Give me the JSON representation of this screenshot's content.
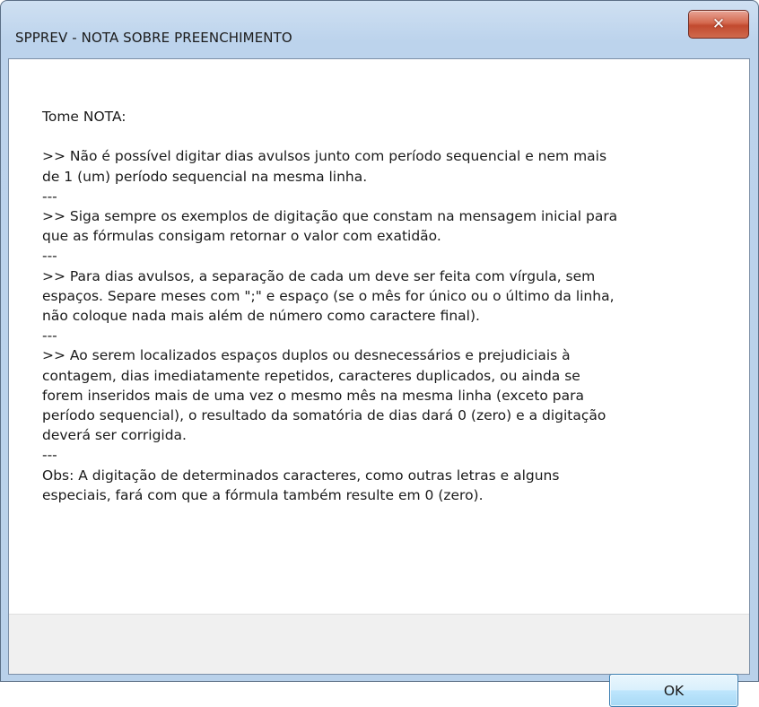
{
  "window": {
    "title": "SPPREV - NOTA SOBRE PREENCHIMENTO",
    "close_icon": "close-icon"
  },
  "message": {
    "lines": [
      "Tome NOTA:",
      "",
      ">> Não é possível digitar dias avulsos junto com período sequencial e nem mais",
      "de 1 (um) período sequencial na mesma linha.",
      "---",
      ">> Siga sempre os exemplos de digitação que constam na mensagem inicial para",
      "que as fórmulas consigam retornar o valor com exatidão.",
      "---",
      ">> Para dias avulsos, a separação de cada um deve ser feita com vírgula, sem",
      "espaços. Separe meses com \";\" e espaço (se o mês for único ou o último da linha,",
      "não coloque nada mais além de número como caractere final).",
      "---",
      ">> Ao serem localizados espaços duplos ou desnecessários e prejudiciais à",
      "contagem, dias imediatamente repetidos, caracteres duplicados, ou ainda se",
      "forem inseridos mais de uma vez o mesmo mês na mesma linha (exceto para",
      "período sequencial), o resultado da somatória de dias dará 0 (zero) e a digitação",
      "deverá ser corrigida.",
      "---",
      "Obs: A digitação de determinados caracteres, como outras letras e alguns",
      "especiais, fará com que a fórmula também resulte em 0 (zero)."
    ]
  },
  "buttons": {
    "ok_label": "OK"
  }
}
